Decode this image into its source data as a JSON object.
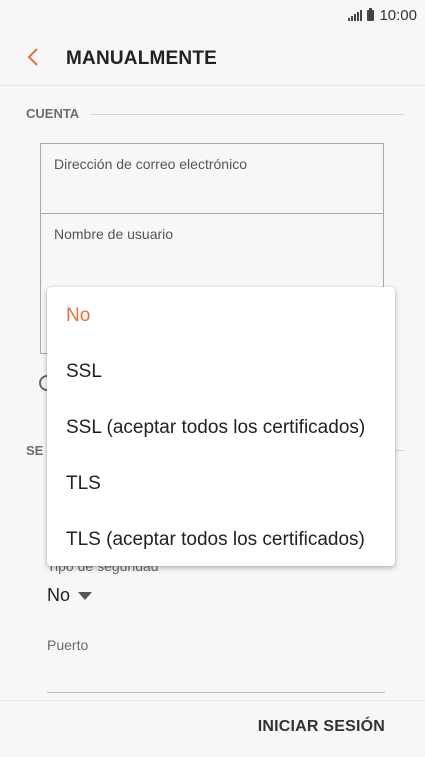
{
  "status_bar": {
    "time": "10:00",
    "signal_icon": "signal-icon",
    "battery_icon": "battery-icon"
  },
  "header": {
    "title": "MANUALMENTE",
    "back_icon": "chevron-left-icon"
  },
  "account_section": {
    "title": "CUENTA",
    "email_label": "Dirección de correo electrónico",
    "username_label": "Nombre de usuario"
  },
  "server_section": {
    "title_visible": "SE"
  },
  "security": {
    "label_partial": "Tipo de seguridad",
    "value": "No"
  },
  "port": {
    "label": "Puerto"
  },
  "dropdown": {
    "options": [
      {
        "label": "No",
        "selected": true
      },
      {
        "label": "SSL",
        "selected": false
      },
      {
        "label": "SSL (aceptar todos los certificados)",
        "selected": false
      },
      {
        "label": "TLS",
        "selected": false
      },
      {
        "label": "TLS (aceptar todos los certificados)",
        "selected": false
      }
    ]
  },
  "footer": {
    "signin_label": "INICIAR SESIÓN"
  },
  "colors": {
    "accent": "#e8703d",
    "background": "#f7f7f7",
    "text": "#222222"
  }
}
